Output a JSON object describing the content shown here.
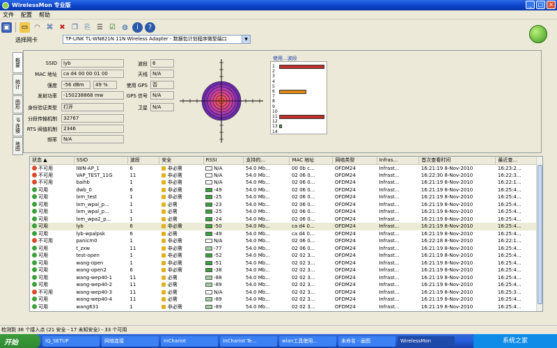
{
  "window": {
    "title": "WirelessMon 专业版",
    "min": "_",
    "max": "□",
    "close": "×"
  },
  "menu": [
    "文件",
    "配置",
    "帮助"
  ],
  "toolbar_icons": [
    "save-icon",
    "open-icon",
    "graph-icon",
    "network-icon",
    "delete-icon",
    "copy-icon",
    "paste-icon",
    "log-icon",
    "check-icon",
    "web-icon",
    "info-icon",
    "help-icon"
  ],
  "adapter": {
    "label": "选择网卡",
    "value": "TP-LINK TL-WN821N 11N Wireless Adapter - 数据包计划程序微型端口"
  },
  "tabs": [
    "概要",
    "统计",
    "图形",
    "IP 连接",
    "地图"
  ],
  "info": {
    "ssid_label": "SSID",
    "ssid": "lyb",
    "mac_label": "MAC 地址",
    "mac": "ca d4 00 00 01 00",
    "strength_label": "强度",
    "strength": "-56 dBm",
    "strength_pct": "49 %",
    "tx_label": "发射功率",
    "tx": "-150238868 mw",
    "auth_label": "身份验证类型",
    "auth": "打开",
    "frag_label": "分段传输机制",
    "frag": "32767",
    "rts_label": "RTS 阀值机制",
    "rts": "2346",
    "freq_label": "频率",
    "freq": "N/A",
    "channel_label": "波段",
    "channel": "6",
    "antenna_label": "天线",
    "antenna": "N/A",
    "gps_use_label": "使用 GPS",
    "gps_use": "否",
    "gps_sig_label": "GPS 信号",
    "gps_sig": "N/A",
    "sat_label": "卫星",
    "sat": "N/A"
  },
  "band_chart": {
    "title": "使用...波段",
    "channels": [
      "1",
      "2",
      "3",
      "4",
      "5",
      "6",
      "7",
      "8",
      "9",
      "10",
      "11",
      "12",
      "13",
      "14"
    ],
    "usage": [
      10,
      0,
      0,
      0,
      0,
      6,
      0,
      0,
      0,
      0,
      10,
      0,
      0,
      0
    ],
    "colors": {
      "1": "#c0302a",
      "6": "#e08a1a",
      "11": "#c0302a",
      "13": "#3aa03a"
    }
  },
  "table": {
    "headers": [
      "状态 ▲",
      "SSID",
      "波段",
      "安全",
      "RSSI",
      "支持的...",
      "MAC 地址",
      "网络类型",
      "Infras...",
      "首次查看时间",
      "最近查..."
    ],
    "rows": [
      [
        "不可用",
        "IWN-AP_1",
        "6",
        "非必需",
        "N/A",
        "54.0 Mb...",
        "00 0b c...",
        "OFDM24",
        "Infrast...",
        "16:21:19 8-Nov-2010",
        "16:23:2..."
      ],
      [
        "不可用",
        "VAP_TEST_11G",
        "11",
        "非必需",
        "N/A",
        "54.0 Mb...",
        "02 06 0...",
        "OFDM24",
        "Infrast...",
        "16:22:30 8-Nov-2010",
        "16:22:3..."
      ],
      [
        "不可用",
        "baihb",
        "1",
        "非必需",
        "N/A",
        "54.0 Mb...",
        "02 06 0...",
        "OFDM24",
        "Infrast...",
        "16:21:19 8-Nov-2010",
        "16:22:1..."
      ],
      [
        "可用",
        "dwb_0",
        "6",
        "非必需",
        "-49",
        "54.0 Mb...",
        "02 06 0...",
        "OFDM24",
        "Infrast...",
        "16:21:19 8-Nov-2010",
        "16:25:4..."
      ],
      [
        "可用",
        "lxm_test",
        "1",
        "非必需",
        "-25",
        "54.0 Mb...",
        "02 06 0...",
        "OFDM24",
        "Infrast...",
        "16:21:19 8-Nov-2010",
        "16:25:4..."
      ],
      [
        "可用",
        "lxm_wpal_p...",
        "1",
        "必需",
        "-23",
        "54.0 Mb...",
        "02 06 0...",
        "OFDM24",
        "Infrast...",
        "16:21:19 8-Nov-2010",
        "16:25:4..."
      ],
      [
        "可用",
        "lxm_wpal_p...",
        "1",
        "必需",
        "-25",
        "54.0 Mb...",
        "02 06 0...",
        "OFDM24",
        "Infrast...",
        "16:21:19 8-Nov-2010",
        "16:25:4..."
      ],
      [
        "可用",
        "lxm_wpa2_p...",
        "1",
        "必需",
        "-24",
        "54.0 Mb...",
        "02 06 0...",
        "OFDM24",
        "Infrast...",
        "16:21:19 8-Nov-2010",
        "16:25:4..."
      ],
      [
        "可用",
        "lyb",
        "6",
        "非必需",
        "-50",
        "54.0 Mb...",
        "ca d4 0...",
        "OFDM24",
        "Infrast...",
        "16:21:19 8-Nov-2010",
        "16:25:4..."
      ],
      [
        "可用",
        "lyb-wpalpsk",
        "6",
        "必需",
        "-49",
        "54.0 Mb...",
        "ca d4 0...",
        "OFDM24",
        "Infrast...",
        "16:21:19 8-Nov-2010",
        "16:25:4..."
      ],
      [
        "不可用",
        "panicm0",
        "1",
        "非必需",
        "N/A",
        "54.0 Mb...",
        "02 06 0...",
        "OFDM24",
        "Infrast...",
        "16:22:18 8-Nov-2010",
        "16:22:1..."
      ],
      [
        "可用",
        "t_zxw",
        "11",
        "非必需",
        "-77",
        "54.0 Mb...",
        "02 06 0...",
        "OFDM24",
        "Infrast...",
        "16:21:19 8-Nov-2010",
        "16:25:4..."
      ],
      [
        "可用",
        "test-open",
        "1",
        "非必需",
        "-52",
        "54.0 Mb...",
        "02 02 3...",
        "OFDM24",
        "Infrast...",
        "16:21:19 8-Nov-2010",
        "16:25:4..."
      ],
      [
        "可用",
        "wang-open",
        "1",
        "非必需",
        "-51",
        "54.0 Mb...",
        "02 02 3...",
        "OFDM24",
        "Infrast...",
        "16:21:19 8-Nov-2010",
        "16:25:4..."
      ],
      [
        "可用",
        "wang-open2",
        "6",
        "非必需",
        "-38",
        "54.0 Mb...",
        "02 02 3...",
        "OFDM24",
        "Infrast...",
        "16:21:19 8-Nov-2010",
        "16:25:4..."
      ],
      [
        "可用",
        "wang-wep40-1",
        "11",
        "必需",
        "-88",
        "54.0 Mb...",
        "02 02 3...",
        "OFDM24",
        "Infrast...",
        "16:21:19 8-Nov-2010",
        "16:25:4..."
      ],
      [
        "可用",
        "wang-wep40-2",
        "11",
        "必需",
        "-89",
        "54.0 Mb...",
        "02 02 3...",
        "OFDM24",
        "Infrast...",
        "16:21:19 8-Nov-2010",
        "16:25:4..."
      ],
      [
        "不可用",
        "wang-wep40-3",
        "11",
        "必需",
        "N/A",
        "54.0 Mb...",
        "02 02 3...",
        "OFDM24",
        "Infrast...",
        "16:21:19 8-Nov-2010",
        "16:25:3..."
      ],
      [
        "可用",
        "wang-wep40-4",
        "11",
        "必需",
        "-89",
        "54.0 Mb...",
        "02 02 3...",
        "OFDM24",
        "Infrast...",
        "16:21:19 8-Nov-2010",
        "16:25:4..."
      ],
      [
        "可用",
        "wang631",
        "1",
        "非必需",
        "-89",
        "54.0 Mb...",
        "02 02 3...",
        "OFDM24",
        "Infrast...",
        "16:21:19 8-Nov-2010",
        "16:25:4..."
      ]
    ],
    "selected_index": 8
  },
  "status": "检测到 38 个接入点 (21 安全 - 17 未知安全) - 33 个可用",
  "taskbar": {
    "start": "开始",
    "tasks": [
      "IQ_SETUP",
      "网络连接",
      "InChariot",
      "InChariot Te...",
      "wlan工具使用...",
      "未命名 - 画图",
      "WirelessMon"
    ],
    "active": 6,
    "tray": "系统之家"
  },
  "colors": {
    "available": "#3aa03a",
    "unavailable": "#d94a2a"
  }
}
